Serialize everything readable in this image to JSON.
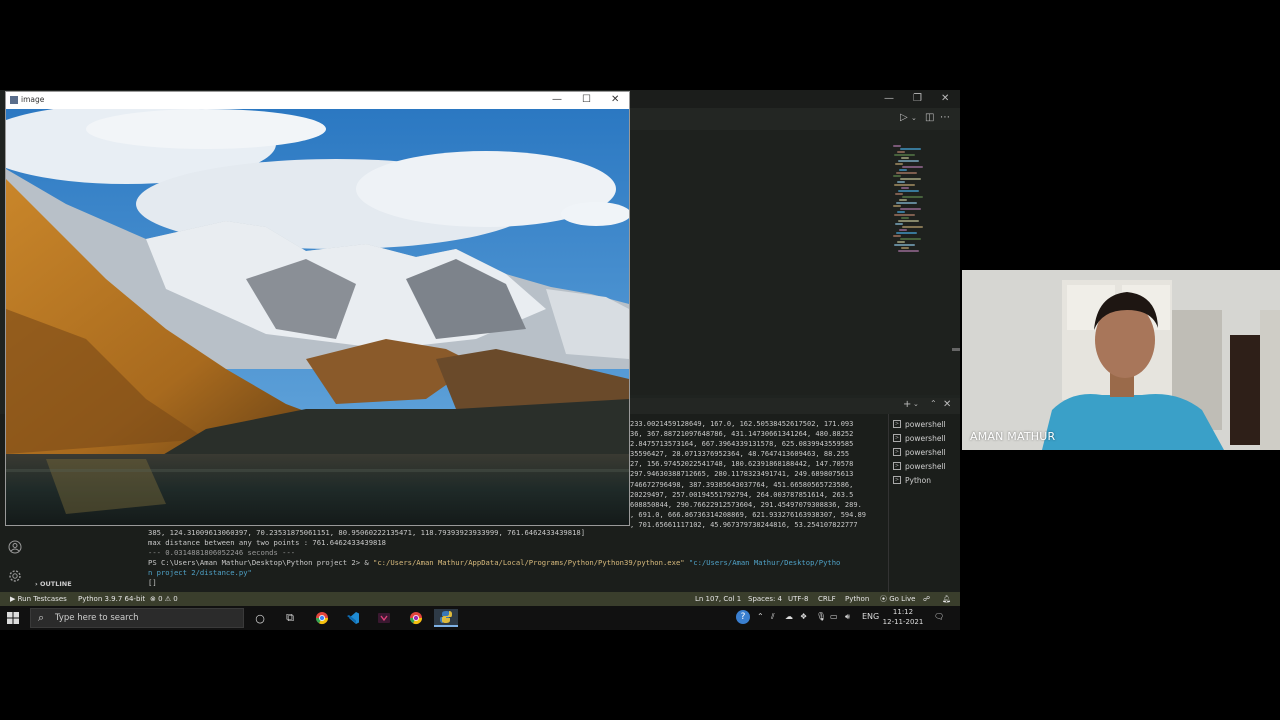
{
  "image_window": {
    "title": "image"
  },
  "terminal": {
    "lines": [
      "233.0021459128649, 167.0, 162.50538452617502, 171.093",
      "36, 367.88721097648786, 431.14730661341264, 480.88252",
      "2.8475713573164, 667.3964339131578, 625.0839943559585",
      "35596427, 28.0713376952364, 48.7647413609463, 88.255",
      "27, 156.97452022541748, 180.62391868188442, 147.70578",
      "297.94630388712665, 280.1178323491741, 249.6898075613",
      "746672796498, 387.39385643037764, 451.66580565723586,",
      "20229497, 257.00194551792794, 264.003787851614, 263.5",
      "608850844, 290.76622912573604, 291.45497079308836, 289.",
      ", 691.0, 666.86736314208869, 621.933276163938307, 594.89",
      ", 701.65661117102, 45.967379738244816, 53.254107822777"
    ],
    "partial_line": "385, 124.31009613060397, 70.23531875061151, 80.95060222135471, 118.79393923933999, 761.6462433439818]",
    "max_distance_line": "max distance between any two points : 761.6462433439818",
    "seconds_line": "--- 0.0314881806052246 seconds ---",
    "prompt": "PS C:\\Users\\Aman Mathur\\Desktop\\Python project 2> & ",
    "python_exe": "\"c:/Users/Aman Mathur/AppData/Local/Programs/Python/Python39/python.exe\"",
    "script_path": "\"c:/Users/Aman Mathur/Desktop/Pytho",
    "script_path_cont": "n project 2/distance.py\"",
    "cursor": "[]",
    "sessions": [
      "powershell",
      "powershell",
      "powershell",
      "powershell",
      "Python"
    ]
  },
  "sidebar": {
    "outline_label": "OUTLINE"
  },
  "statusbar": {
    "run_testcases": "Run Testcases",
    "interpreter": "Python 3.9.7 64-bit",
    "problems": "⊗ 0 ⚠ 0",
    "cursor_pos": "Ln 107, Col 1",
    "spaces": "Spaces: 4",
    "encoding": "UTF-8",
    "eol": "CRLF",
    "language": "Python",
    "go_live": "Go Live"
  },
  "taskbar": {
    "search_placeholder": "Type here to search",
    "language": "ENG",
    "time": "11:12",
    "date": "12-11-2021"
  },
  "webcam": {
    "name": "AMAN MATHUR"
  }
}
